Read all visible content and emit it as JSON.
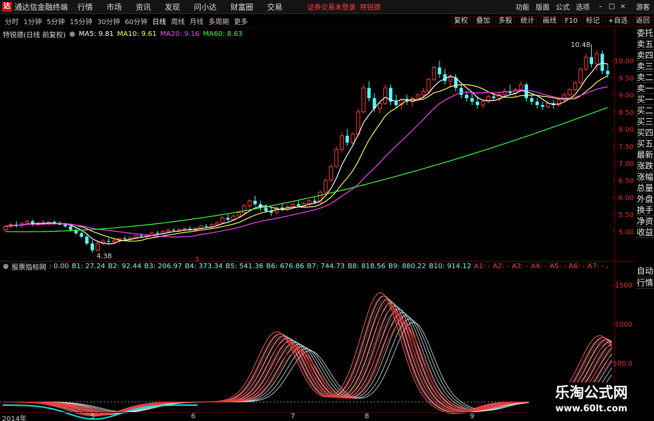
{
  "app_title": "通达信金融终端",
  "menu": [
    "行情",
    "市场",
    "资讯",
    "发现",
    "问小达",
    "财富圈",
    "交易"
  ],
  "login_status": "证券交易未登录",
  "login_name": "特锐德",
  "top_right": [
    "功能",
    "版面",
    "公式",
    "选项"
  ],
  "guest": "游客",
  "window_buttons": [
    "–",
    "□",
    "×"
  ],
  "periods": [
    "分时",
    "1分钟",
    "5分钟",
    "15分钟",
    "30分钟",
    "60分钟",
    "日线",
    "周线",
    "月线",
    "多周期",
    "更多"
  ],
  "active_period": "日线",
  "toolbar": [
    "复权",
    "叠加",
    "多股",
    "统计",
    "画线",
    "F10",
    "标记",
    "+自选",
    "返回"
  ],
  "stock_label": "特锐德(日线 前复权)",
  "ma": [
    {
      "label": "MA5: 9.81",
      "color": "#ffffff"
    },
    {
      "label": "MA10: 9.61",
      "color": "#ffff66"
    },
    {
      "label": "MA20: 9.16",
      "color": "#ff44ff"
    },
    {
      "label": "MA60: 8.63",
      "color": "#44ff44"
    }
  ],
  "sidebar": [
    "委托",
    "卖五",
    "卖四",
    "卖三",
    "卖二",
    "卖一",
    "买一",
    "买二",
    "买三",
    "买四",
    "买五",
    "最新",
    "涨跌",
    "涨幅",
    "总量",
    "外盘",
    "换手",
    "净资",
    "收益"
  ],
  "indicator_name": "股票指标网",
  "indicator_values": [
    {
      "label": ": 0.00",
      "color": "#cccccc"
    },
    {
      "label": "B1: 27.24",
      "color": "#8ef0f0"
    },
    {
      "label": "B2: 92.44",
      "color": "#8ef0f0"
    },
    {
      "label": "B3: 206.97",
      "color": "#8ef0f0"
    },
    {
      "label": "B4: 373.34",
      "color": "#8ef0f0"
    },
    {
      "label": "B5: 541.36",
      "color": "#8ef0f0"
    },
    {
      "label": "B6: 676.86",
      "color": "#8ef0f0"
    },
    {
      "label": "B7: 744.73",
      "color": "#8ef0f0"
    },
    {
      "label": "B8: 818.56",
      "color": "#8ef0f0"
    },
    {
      "label": "B9: 880.22",
      "color": "#8ef0f0"
    },
    {
      "label": "B10: 914.12",
      "color": "#8ef0f0"
    },
    {
      "label": "A1: -",
      "color": "#ff4444"
    },
    {
      "label": "A2: -",
      "color": "#ff4444"
    },
    {
      "label": "A3: -",
      "color": "#ff4444"
    },
    {
      "label": "A4: -",
      "color": "#ff4444"
    },
    {
      "label": "A5: -",
      "color": "#ff4444"
    },
    {
      "label": "A6: -",
      "color": "#ff4444"
    },
    {
      "label": "A7: -",
      "color": "#ff4444"
    },
    {
      "label": "A8: -",
      "color": "#ff4444"
    },
    {
      "label": "A9: -",
      "color": "#ff4444"
    },
    {
      "label": "A10: 914.12",
      "color": "#ff4444"
    }
  ],
  "auto_side": [
    "自动",
    "行情"
  ],
  "watermark": {
    "main": "乐淘公式网",
    "sub": "www.60lt.com"
  },
  "xaxis": [
    "2014年",
    "5",
    "6",
    "7",
    "8",
    "9"
  ],
  "price_axis": [
    "10.00",
    "9.50",
    "9.00",
    "8.50",
    "8.00",
    "7.50",
    "7.00",
    "6.50",
    "6.00",
    "5.50",
    "5.00"
  ],
  "price_small": "5.00",
  "ind_axis": [
    "1500",
    "1000",
    "500.0",
    "0.00"
  ],
  "annotations": {
    "high": "10.48",
    "low": "4.38",
    "marker": "S"
  },
  "chart_data": {
    "type": "candlestick",
    "price_ylim": [
      4.25,
      10.6
    ],
    "candles": [
      [
        5.05,
        5.18,
        5.0,
        5.15
      ],
      [
        5.15,
        5.25,
        5.1,
        5.2
      ],
      [
        5.2,
        5.3,
        5.12,
        5.18
      ],
      [
        5.18,
        5.28,
        5.1,
        5.24
      ],
      [
        5.24,
        5.35,
        5.2,
        5.3
      ],
      [
        5.3,
        5.35,
        5.15,
        5.2
      ],
      [
        5.2,
        5.28,
        5.15,
        5.25
      ],
      [
        5.25,
        5.32,
        5.2,
        5.22
      ],
      [
        5.22,
        5.3,
        5.18,
        5.28
      ],
      [
        5.28,
        5.33,
        5.2,
        5.25
      ],
      [
        5.25,
        5.3,
        5.18,
        5.2
      ],
      [
        5.2,
        5.26,
        5.12,
        5.15
      ],
      [
        5.15,
        5.2,
        5.0,
        5.05
      ],
      [
        5.05,
        5.1,
        4.9,
        4.95
      ],
      [
        4.95,
        5.0,
        4.8,
        4.85
      ],
      [
        4.85,
        4.9,
        4.6,
        4.65
      ],
      [
        4.65,
        4.75,
        4.38,
        4.45
      ],
      [
        4.45,
        4.7,
        4.42,
        4.65
      ],
      [
        4.65,
        4.78,
        4.6,
        4.72
      ],
      [
        4.72,
        4.8,
        4.65,
        4.7
      ],
      [
        4.7,
        4.78,
        4.62,
        4.74
      ],
      [
        4.74,
        4.82,
        4.7,
        4.8
      ],
      [
        4.8,
        4.86,
        4.74,
        4.78
      ],
      [
        4.78,
        4.85,
        4.72,
        4.82
      ],
      [
        4.82,
        4.9,
        4.78,
        4.88
      ],
      [
        4.88,
        4.95,
        4.82,
        4.86
      ],
      [
        4.86,
        4.94,
        4.8,
        4.9
      ],
      [
        4.9,
        5.0,
        4.86,
        4.96
      ],
      [
        4.96,
        5.02,
        4.9,
        4.95
      ],
      [
        4.95,
        5.05,
        4.92,
        5.0
      ],
      [
        5.0,
        5.08,
        4.95,
        5.04
      ],
      [
        5.04,
        5.1,
        5.0,
        5.02
      ],
      [
        5.02,
        5.1,
        4.98,
        5.06
      ],
      [
        5.06,
        5.12,
        5.02,
        5.08
      ],
      [
        5.08,
        5.15,
        5.02,
        5.05
      ],
      [
        5.05,
        5.12,
        5.0,
        5.1
      ],
      [
        5.1,
        5.2,
        5.06,
        5.16
      ],
      [
        5.16,
        5.22,
        5.1,
        5.14
      ],
      [
        5.14,
        5.24,
        5.1,
        5.2
      ],
      [
        5.2,
        5.3,
        5.15,
        5.25
      ],
      [
        5.25,
        5.45,
        5.22,
        5.4
      ],
      [
        5.4,
        5.5,
        5.3,
        5.35
      ],
      [
        5.35,
        5.5,
        5.32,
        5.45
      ],
      [
        5.45,
        5.6,
        5.4,
        5.55
      ],
      [
        5.55,
        5.8,
        5.5,
        5.75
      ],
      [
        5.75,
        5.95,
        5.7,
        5.9
      ],
      [
        5.9,
        6.05,
        5.75,
        5.8
      ],
      [
        5.8,
        5.9,
        5.6,
        5.7
      ],
      [
        5.7,
        5.8,
        5.55,
        5.6
      ],
      [
        5.6,
        5.7,
        5.45,
        5.55
      ],
      [
        5.55,
        5.75,
        5.5,
        5.7
      ],
      [
        5.7,
        5.8,
        5.6,
        5.65
      ],
      [
        5.65,
        5.78,
        5.6,
        5.72
      ],
      [
        5.72,
        5.85,
        5.68,
        5.8
      ],
      [
        5.8,
        5.9,
        5.7,
        5.75
      ],
      [
        5.75,
        5.88,
        5.7,
        5.82
      ],
      [
        5.82,
        5.95,
        5.78,
        5.9
      ],
      [
        5.9,
        6.0,
        5.8,
        5.85
      ],
      [
        5.85,
        6.2,
        5.82,
        6.15
      ],
      [
        6.15,
        6.55,
        6.1,
        6.5
      ],
      [
        6.5,
        6.95,
        6.45,
        6.9
      ],
      [
        6.9,
        7.5,
        6.85,
        7.4
      ],
      [
        7.4,
        7.9,
        7.3,
        7.8
      ],
      [
        7.8,
        8.0,
        7.5,
        7.6
      ],
      [
        7.6,
        7.9,
        7.55,
        7.85
      ],
      [
        7.85,
        8.6,
        7.8,
        8.5
      ],
      [
        8.5,
        9.3,
        8.45,
        9.2
      ],
      [
        9.2,
        9.4,
        8.8,
        8.9
      ],
      [
        8.9,
        9.05,
        8.5,
        8.6
      ],
      [
        8.6,
        8.8,
        8.45,
        8.75
      ],
      [
        8.75,
        9.3,
        8.7,
        9.2
      ],
      [
        9.2,
        9.3,
        8.7,
        8.8
      ],
      [
        8.8,
        9.0,
        8.6,
        8.7
      ],
      [
        8.7,
        8.9,
        8.55,
        8.85
      ],
      [
        8.85,
        9.0,
        8.7,
        8.8
      ],
      [
        8.8,
        8.95,
        8.65,
        8.9
      ],
      [
        8.9,
        9.05,
        8.8,
        9.0
      ],
      [
        9.0,
        9.2,
        8.9,
        9.1
      ],
      [
        9.1,
        9.5,
        9.05,
        9.45
      ],
      [
        9.45,
        9.85,
        9.4,
        9.8
      ],
      [
        9.8,
        10.0,
        9.5,
        9.6
      ],
      [
        9.6,
        9.75,
        9.3,
        9.4
      ],
      [
        9.4,
        9.6,
        9.2,
        9.5
      ],
      [
        9.5,
        9.6,
        9.1,
        9.2
      ],
      [
        9.2,
        9.3,
        8.9,
        9.0
      ],
      [
        9.0,
        9.1,
        8.8,
        8.9
      ],
      [
        8.9,
        9.05,
        8.7,
        8.8
      ],
      [
        8.8,
        8.95,
        8.6,
        8.7
      ],
      [
        8.7,
        8.85,
        8.6,
        8.8
      ],
      [
        8.8,
        9.0,
        8.75,
        8.95
      ],
      [
        8.95,
        9.05,
        8.85,
        8.9
      ],
      [
        8.9,
        9.1,
        8.8,
        9.0
      ],
      [
        9.0,
        9.2,
        8.9,
        9.1
      ],
      [
        9.1,
        9.3,
        9.0,
        9.05
      ],
      [
        9.05,
        9.2,
        8.95,
        9.15
      ],
      [
        9.15,
        9.4,
        9.1,
        9.3
      ],
      [
        9.3,
        9.35,
        8.8,
        8.9
      ],
      [
        8.9,
        9.0,
        8.7,
        8.8
      ],
      [
        8.8,
        8.9,
        8.6,
        8.7
      ],
      [
        8.7,
        8.8,
        8.55,
        8.65
      ],
      [
        8.65,
        8.8,
        8.6,
        8.75
      ],
      [
        8.75,
        8.85,
        8.6,
        8.7
      ],
      [
        8.7,
        8.9,
        8.65,
        8.85
      ],
      [
        8.85,
        9.05,
        8.8,
        9.0
      ],
      [
        9.0,
        9.2,
        8.95,
        9.15
      ],
      [
        9.15,
        9.4,
        9.1,
        9.35
      ],
      [
        9.35,
        9.8,
        9.3,
        9.75
      ],
      [
        9.75,
        10.2,
        9.7,
        10.1
      ],
      [
        10.1,
        10.48,
        9.8,
        9.9
      ],
      [
        9.9,
        10.3,
        9.7,
        10.2
      ],
      [
        10.2,
        10.3,
        9.6,
        9.7
      ],
      [
        9.7,
        9.9,
        9.5,
        9.6
      ]
    ],
    "ma": {
      "MA5": 9.81,
      "MA10": 9.61,
      "MA20": 9.16,
      "MA60": 8.63
    },
    "ma60_range": [
      5.0,
      8.63
    ],
    "indicator_ylim": [
      -120,
      1650
    ],
    "indicator_type": "rainbow-band"
  }
}
